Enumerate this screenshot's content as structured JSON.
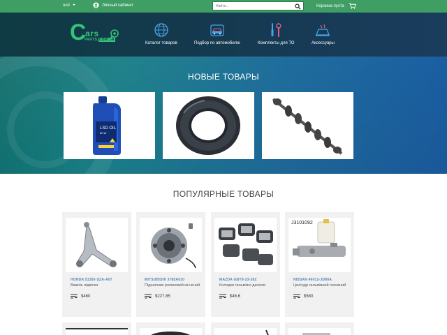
{
  "topbar": {
    "currency": "usd",
    "account_label": "Личный кабинет",
    "search_placeholder": "Найти...",
    "cart_label": "Корзина пуста"
  },
  "logo": {
    "letter": "C",
    "word": "ars",
    "sub": "PARTS.",
    "badge": "COM.UA"
  },
  "nav": [
    {
      "label": "Каталог товаров",
      "icon": "globe-icon"
    },
    {
      "label": "Подбор по автомобилю",
      "icon": "car-icon"
    },
    {
      "label": "Комплекты для ТО",
      "icon": "tools-icon"
    },
    {
      "label": "Аксессуары",
      "icon": "car-wash-icon"
    }
  ],
  "hero": {
    "title": "НОВЫЕ ТОВАРЫ",
    "products": [
      {
        "icon": "oil-bottle-icon",
        "bottle_text_1": "LSD OIL",
        "bottle_text_2": "80 W"
      },
      {
        "icon": "seal-ring-icon"
      },
      {
        "icon": "camshaft-icon"
      }
    ]
  },
  "popular": {
    "title": "ПОПУЛЯРНЫЕ ТОВАРЫ",
    "items": [
      {
        "name": "HONDA 51350-SZA-A07",
        "desc": "Важіль підвіски",
        "price": "$460",
        "icon": "control-arm-icon"
      },
      {
        "name": "MITSUBISHI 3785A010",
        "desc": "Підшипник роликовий кінчений",
        "price": "$227.85",
        "icon": "wheel-hub-icon"
      },
      {
        "name": "MAZDA GBY9-33-28Z",
        "desc": "Колодки гальмівні дискові",
        "price": "$46.6",
        "icon": "brake-pads-icon"
      },
      {
        "name": "NISSAN 46012-JD80A",
        "desc": "Циліндр гальмівний головний",
        "price": "$580",
        "icon": "master-cylinder-icon",
        "image_text": "J3101092"
      }
    ]
  },
  "colors": {
    "green": "#3f9e63",
    "accent": "#35c27a",
    "navy": "#0f3b44",
    "link": "#4f86b8"
  }
}
